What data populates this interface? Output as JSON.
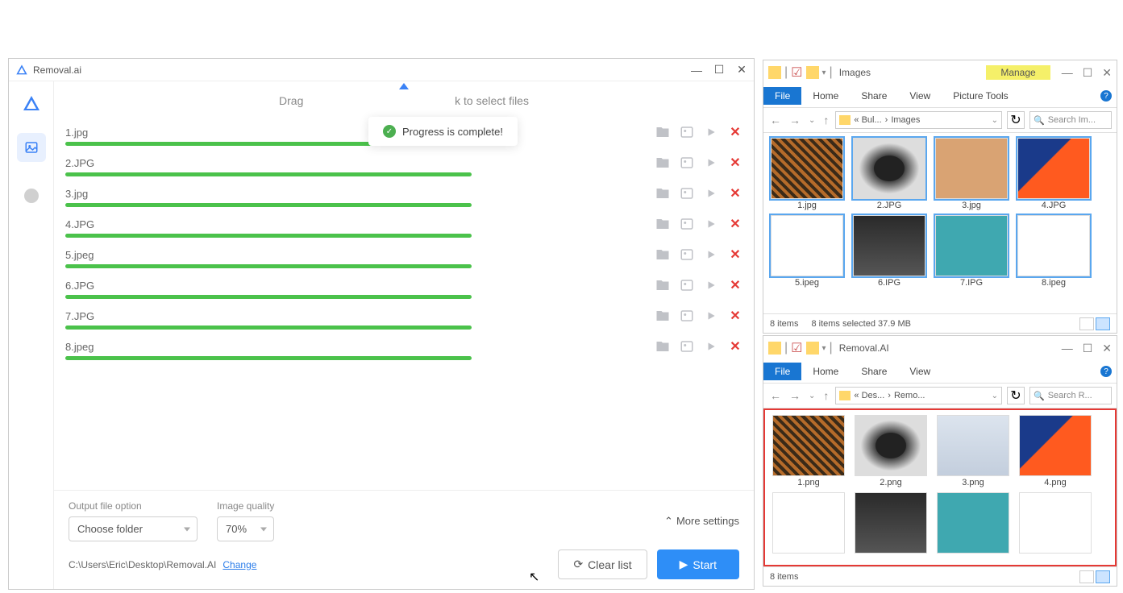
{
  "app": {
    "title": "Removal.ai",
    "dropzone_text_left": "Drag",
    "dropzone_text_right": "k to select files",
    "toast": "Progress is complete!",
    "files": [
      {
        "name": "1.jpg",
        "progress": 100
      },
      {
        "name": "2.JPG",
        "progress": 100
      },
      {
        "name": "3.jpg",
        "progress": 100
      },
      {
        "name": "4.JPG",
        "progress": 100
      },
      {
        "name": "5.jpeg",
        "progress": 100
      },
      {
        "name": "6.JPG",
        "progress": 100
      },
      {
        "name": "7.JPG",
        "progress": 100
      },
      {
        "name": "8.jpeg",
        "progress": 100
      }
    ],
    "output_option_label": "Output file option",
    "output_option_value": "Choose folder",
    "quality_label": "Image quality",
    "quality_value": "70%",
    "more_settings": "More settings",
    "output_path": "C:\\Users\\Eric\\Desktop\\Removal.AI",
    "change_link": "Change",
    "clear_list": "Clear list",
    "start": "Start"
  },
  "explorer_top": {
    "title": "Images",
    "manage_tab": "Manage",
    "ribbon": {
      "file": "File",
      "home": "Home",
      "share": "Share",
      "view": "View",
      "picture_tools": "Picture Tools"
    },
    "breadcrumb": {
      "parent": "« Bul...",
      "current": "Images"
    },
    "search_placeholder": "Search Im...",
    "thumbs": [
      {
        "name": "1.jpg",
        "cls": "plaid"
      },
      {
        "name": "2.JPG",
        "cls": "cup"
      },
      {
        "name": "3.jpg",
        "cls": "shirt2"
      },
      {
        "name": "4.JPG",
        "cls": "shoes"
      },
      {
        "name": "5.ipeg",
        "cls": "racket"
      },
      {
        "name": "6.IPG",
        "cls": "coffee"
      },
      {
        "name": "7.IPG",
        "cls": "tank"
      },
      {
        "name": "8.ipeg",
        "cls": "racket2"
      }
    ],
    "status_items": "8 items",
    "status_selected": "8 items selected  37.9 MB"
  },
  "explorer_bot": {
    "title": "Removal.AI",
    "ribbon": {
      "file": "File",
      "home": "Home",
      "share": "Share",
      "view": "View"
    },
    "breadcrumb": {
      "parent": "« Des...",
      "current": "Remo..."
    },
    "search_placeholder": "Search R...",
    "thumbs": [
      {
        "name": "1.png",
        "cls": "plaid"
      },
      {
        "name": "2.png",
        "cls": "cup"
      },
      {
        "name": "3.png",
        "cls": "shirt"
      },
      {
        "name": "4.png",
        "cls": "shoes"
      },
      {
        "name": "",
        "cls": "racket"
      },
      {
        "name": "",
        "cls": "coffee"
      },
      {
        "name": "",
        "cls": "tank"
      },
      {
        "name": "",
        "cls": "racket2"
      }
    ],
    "status_items": "8 items"
  }
}
